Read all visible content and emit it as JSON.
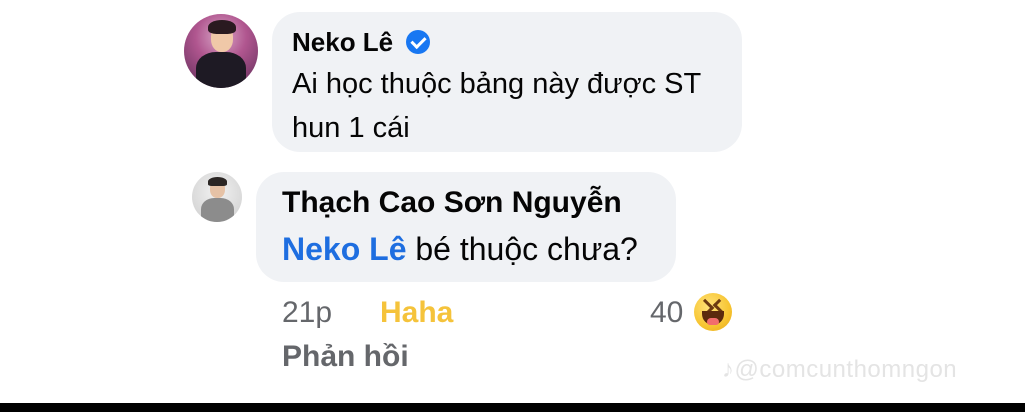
{
  "comments": [
    {
      "author": "Neko Lê",
      "verified": true,
      "text": "Ai học thuộc bảng này được ST hun 1 cái"
    },
    {
      "author": "Thạch Cao Sơn Nguyễn",
      "mention": "Neko Lê",
      "text": " bé thuộc chưa?",
      "time": "21p",
      "reaction_label": "Haha",
      "reaction_count": "40",
      "reply_label": "Phản hồi"
    }
  ],
  "watermark": "@comcunthomngon",
  "colors": {
    "bubble": "#f0f2f5",
    "mention": "#1e6ee0",
    "haha": "#f5c33b",
    "meta": "#65676b",
    "verified": "#1877f2"
  }
}
